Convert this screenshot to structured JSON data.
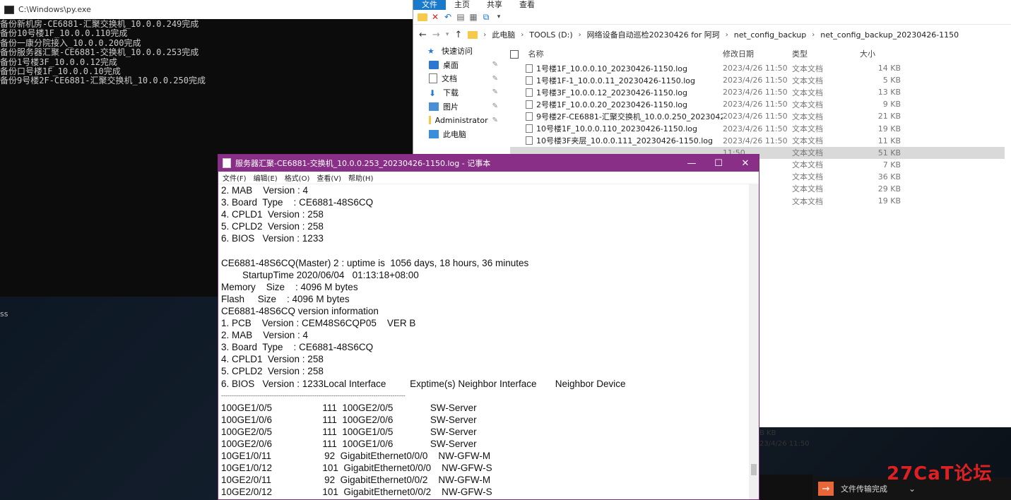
{
  "console": {
    "title": "C:\\Windows\\py.exe",
    "lines": [
      "备份新机房-CE6881-汇聚交换机_10.0.0.249完成",
      "备份10号楼1F_10.0.0.110完成",
      "备份一康分院接入_10.0.0.200完成",
      "备份服务器汇聚-CE6881-交换机_10.0.0.253完成",
      "备份1号楼3F_10.0.0.12完成",
      "备份口号楼1F_10.0.0.10完成",
      "备份9号楼2F-CE6881-汇聚交换机_10.0.0.250完成"
    ]
  },
  "desktop": {
    "frag1": "ss"
  },
  "explorer": {
    "ribbon_tabs": [
      "文件",
      "主页",
      "共享",
      "查看"
    ],
    "breadcrumb": [
      "此电脑",
      "TOOLS (D:)",
      "网络设备自动巡检20230426 for 阿珂",
      "net_config_backup",
      "net_config_backup_20230426-1150"
    ],
    "nav_items": [
      {
        "label": "快速访问",
        "icon": "star-icon"
      },
      {
        "label": "桌面",
        "icon": "desktop-icon"
      },
      {
        "label": "文档",
        "icon": "documents-icon"
      },
      {
        "label": "下载",
        "icon": "download-icon"
      },
      {
        "label": "图片",
        "icon": "pictures-icon"
      },
      {
        "label": "Administrator",
        "icon": "folder-icon"
      },
      {
        "label": "此电脑",
        "icon": "computer-icon"
      }
    ],
    "columns": {
      "name": "名称",
      "date": "修改日期",
      "type": "类型",
      "size": "大小"
    },
    "files": [
      {
        "name": "1号楼1F_10.0.0.10_20230426-1150.log",
        "date": "2023/4/26 11:50",
        "type": "文本文档",
        "size": "14 KB"
      },
      {
        "name": "1号楼1F-1_10.0.0.11_20230426-1150.log",
        "date": "2023/4/26 11:50",
        "type": "文本文档",
        "size": "5 KB"
      },
      {
        "name": "1号楼3F_10.0.0.12_20230426-1150.log",
        "date": "2023/4/26 11:50",
        "type": "文本文档",
        "size": "13 KB"
      },
      {
        "name": "2号楼1F_10.0.0.20_20230426-1150.log",
        "date": "2023/4/26 11:50",
        "type": "文本文档",
        "size": "9 KB"
      },
      {
        "name": "9号楼2F-CE6881-汇聚交换机_10.0.0.250_20230426-...",
        "date": "2023/4/26 11:50",
        "type": "文本文档",
        "size": "21 KB"
      },
      {
        "name": "10号楼1F_10.0.0.110_20230426-1150.log",
        "date": "2023/4/26 11:50",
        "type": "文本文档",
        "size": "19 KB"
      },
      {
        "name": "10号楼3F夹层_10.0.0.111_20230426-1150.log",
        "date": "2023/4/26 11:50",
        "type": "文本文档",
        "size": "11 KB"
      },
      {
        "name": "",
        "date": "11:50",
        "type": "文本文档",
        "size": "51 KB"
      },
      {
        "name": "",
        "date": "11:50",
        "type": "文本文档",
        "size": "7 KB"
      },
      {
        "name": "",
        "date": "11:50",
        "type": "文本文档",
        "size": "36 KB"
      },
      {
        "name": "",
        "date": "11:50",
        "type": "文本文档",
        "size": "29 KB"
      },
      {
        "name": "",
        "date": "11:50",
        "type": "文本文档",
        "size": "19 KB"
      }
    ],
    "details": {
      "size": "B KB",
      "date": "23/4/26 11:50"
    }
  },
  "notepad": {
    "title": "服务器汇聚-CE6881-交换机_10.0.0.253_20230426-1150.log - 记事本",
    "menu": [
      "文件(F)",
      "编辑(E)",
      "格式(O)",
      "查看(V)",
      "帮助(H)"
    ],
    "lines": [
      "2. MAB    Version : 4",
      "3. Board  Type    : CE6881-48S6CQ",
      "4. CPLD1  Version : 258",
      "5. CPLD2  Version : 258",
      "6. BIOS   Version : 1233",
      "",
      "CE6881-48S6CQ(Master) 2 : uptime is  1056 days, 18 hours, 36 minutes",
      "        StartupTime 2020/06/04   01:13:18+08:00",
      "Memory    Size    : 4096 M bytes",
      "Flash     Size    : 4096 M bytes",
      "CE6881-48S6CQ version information",
      "1. PCB    Version : CEM48S6CQP05    VER B",
      "2. MAB    Version : 4",
      "3. Board  Type    : CE6881-48S6CQ",
      "4. CPLD1  Version : 258",
      "5. CPLD2  Version : 258",
      "6. BIOS   Version : 1233Local Interface         Exptime(s) Neighbor Interface       Neighbor Device",
      "---------------------------------------------------------------------------------------",
      "100GE1/0/5                   111  100GE2/0/5              SW-Server",
      "100GE1/0/6                   111  100GE2/0/6              SW-Server",
      "100GE2/0/5                   111  100GE1/0/5              SW-Server",
      "100GE2/0/6                   111  100GE1/0/6              SW-Server",
      "10GE1/0/11                    92  GigabitEthernet0/0/0    NW-GFW-M",
      "10GE1/0/12                   101  GigabitEthernet0/0/0    NW-GFW-S",
      "10GE2/0/11                    92  GigabitEthernet0/0/2    NW-GFW-M",
      "10GE2/0/12                   101  GigabitEthernet0/0/2    NW-GFW-S"
    ]
  },
  "notification": {
    "label": "文件传输完成"
  },
  "watermark": {
    "text": "27CaT论坛"
  }
}
